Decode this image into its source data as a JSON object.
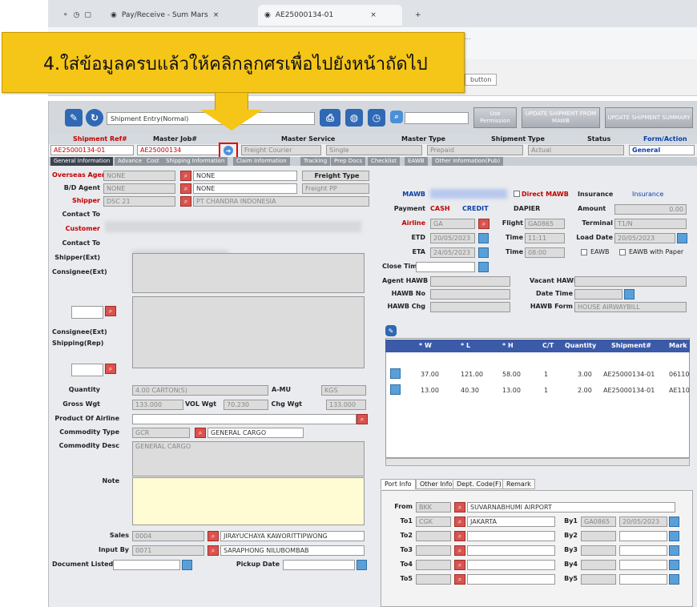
{
  "browser": {
    "tabs": [
      {
        "label": "Pay/Receive - Sum Mars"
      },
      {
        "label": "AE25000134-01"
      }
    ]
  },
  "callout": {
    "text": "4.ใส่ข้อมูลครบแล้วให้คลิกลูกศรเพื่อไปยังหน้าถัดไป"
  },
  "toolbar": {
    "shipment_select": "Shipment Entry(Normal)",
    "user_label": "Use\nPermission",
    "update_shipment_1": "UPDATE SHIPMENT\nFROM MAWB",
    "update_shipment_2": "UPDATE SHIPMENT\nSUMMARY"
  },
  "header_row": {
    "labels": [
      "Shipment Ref#",
      "Master Job#",
      "Master Service",
      "Master Type",
      "Shipment Type",
      "Status",
      "Form/Action"
    ],
    "values": [
      "AE25000134-01",
      "AE25000134",
      "Freight Courier",
      "Single",
      "Prepaid",
      "Actual",
      "General"
    ]
  },
  "main_tabs": [
    "General Information",
    "Advance",
    "Cost",
    "Shipping Information",
    "Claim Information",
    "Tracking",
    "Prep Docs",
    "Checklist",
    "EAWB",
    "Other Information(Pub)"
  ],
  "left": {
    "overseas_agent_label": "Overseas Agent",
    "overseas_agent_code": "NONE",
    "overseas_agent_name": "NONE",
    "freight_type_label": "Freight Type",
    "bill_agent_label": "B/D Agent",
    "bill_agent_code": "NONE",
    "bill_agent_name": "NONE",
    "freight_pp_label": "Freight PP",
    "shipper_label": "Shipper",
    "shipper_code": "DSC 21",
    "shipper_name": "PT CHANDRA INDONESIA",
    "contact_to_label": "Contact To",
    "customer_label": "Customer",
    "contact_to2_label": "Contact To",
    "shipper_ext_label": "Shipper(Ext)",
    "consignee_ext_label": "Consignee(Ext)",
    "consignee_ext2_label": "Consignee(Ext)",
    "shipping_rep_label": "Shipping(Rep)",
    "quantity_label": "Quantity",
    "quantity_value": "4.00 CARTON(S)",
    "a_mu_label": "A-MU",
    "a_mu_value": "KGS",
    "gross_wgt_label": "Gross Wgt",
    "gross_wgt_value": "133.000",
    "vol_wgt_label": "VOL Wgt",
    "vol_wgt_value": "70.230",
    "chg_wgt_label": "Chg Wgt",
    "chg_wgt_value": "133.000",
    "product_label": "Product Of Airline",
    "commodity_type_label": "Commodity Type",
    "commodity_type_code": "GCR",
    "commodity_type_name": "GENERAL CARGO",
    "commodity_desc_label": "Commodity Desc",
    "commodity_desc_value": "GENERAL CARGO",
    "note_label": "Note",
    "sales_label": "Sales",
    "sales_code": "0004",
    "sales_name": "JIRAYUCHAYA KAWORITTIPWONG",
    "input_by_label": "Input By",
    "input_by_code": "0071",
    "input_by_name": "SARAPHONG NILUBOMBAB",
    "doc_listed_label": "Document Listed",
    "pickup_date_label": "Pickup Date"
  },
  "right": {
    "mawb_label": "MAWB",
    "direct_mawb_label": "Direct MAWB",
    "insurance_label": "Insurance",
    "insurance_value": "Insurance",
    "payment_label": "Payment",
    "payment_opts": [
      "CASH",
      "CREDIT"
    ],
    "dapier_label": "DAPIER",
    "amount_label": "Amount",
    "amount_value": "0.00",
    "airline_label": "Airline",
    "airline_code": "GA",
    "flight_label": "Flight",
    "flight_value": "GA0865",
    "terminal_label": "Terminal",
    "terminal_value": "T1/N",
    "etd_label": "ETD",
    "etd_value": "20/05/2023",
    "time_label": "Time",
    "etd_time": "11:11",
    "load_date_label": "Load Date",
    "load_date_value": "20/05/2023",
    "eta_label": "ETA",
    "eta_value": "24/05/2023",
    "eta_time_label": "Time",
    "eta_time": "08:00",
    "eawb_label": "EAWB",
    "eawb_paper_label": "EAWB with Paper",
    "close_time_label": "Close Time",
    "agent_hawb_label": "Agent HAWB",
    "hawb_no_label": "HAWB No",
    "hawb_chg_label": "HAWB Chg",
    "vacant_label": "Vacant HAWB",
    "date_time_label": "Date Time",
    "hawb_form_label": "HAWB Form",
    "hawb_form_value": "HOUSE AIRWAYBILL",
    "grid_headers": [
      "* W",
      "* L",
      "* H",
      "C/T",
      "Quantity",
      "Shipment#",
      "Mark"
    ],
    "grid_rows": [
      [
        "37.00",
        "121.00",
        "58.00",
        "1",
        "3.00",
        "AE25000134-01",
        "06110"
      ],
      [
        "13.00",
        "40.30",
        "13.00",
        "1",
        "2.00",
        "AE25000134-01",
        "AE110"
      ]
    ],
    "sub_tabs": [
      "Port Info",
      "Other Info",
      "Dept. Code(F)",
      "Remark"
    ],
    "from_label": "From",
    "from_code": "BKK",
    "from_name": "SUVARNABHUMI AIRPORT",
    "to1_label": "To1",
    "to1_code": "CGK",
    "to1_name": "JAKARTA",
    "by1_label": "By1",
    "by1_code": "GA0865",
    "by1_date": "20/05/2023",
    "to2_label": "To2",
    "by2_label": "By2",
    "to3_label": "To3",
    "by3_label": "By3",
    "to4_label": "To4",
    "by4_label": "By4",
    "to5_label": "To5",
    "by5_label": "By5"
  },
  "colors": {
    "callout": "#f5c518",
    "highlight": "#e00000",
    "header_blue": "#3b5aa8"
  }
}
